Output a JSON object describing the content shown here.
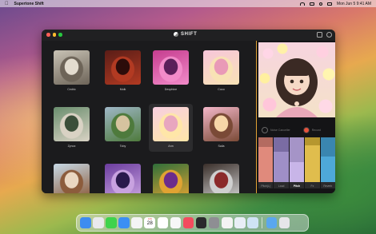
{
  "menubar": {
    "app_name": "Supertone Shift",
    "date_time": "Mon Jun 5  9:41 AM"
  },
  "window": {
    "title": "SHIFT"
  },
  "gallery": {
    "items": [
      {
        "label": "Cedric",
        "palette": [
          "#c8c2b5",
          "#6d6458",
          "#e3dccf"
        ],
        "selected": false
      },
      {
        "label": "Molk",
        "palette": [
          "#5a1d17",
          "#b23a22",
          "#2c0c0a"
        ],
        "selected": false
      },
      {
        "label": "Deophine",
        "palette": [
          "#c53d8f",
          "#f28bc9",
          "#5b1f5a"
        ],
        "selected": false
      },
      {
        "label": "Coco",
        "palette": [
          "#f7c6da",
          "#f8e2b5",
          "#e99ab7"
        ],
        "selected": false
      },
      {
        "label": "Zynox",
        "palette": [
          "#6a8e6e",
          "#d9d2c4",
          "#3b4f3a"
        ],
        "selected": false
      },
      {
        "label": "Toby",
        "palette": [
          "#9fb7c7",
          "#4e7a3c",
          "#d6c39f"
        ],
        "selected": false
      },
      {
        "label": "Ann",
        "palette": [
          "#f7cfe0",
          "#ffe6a8",
          "#e8a6bf"
        ],
        "selected": true
      },
      {
        "label": "Saila",
        "palette": [
          "#f3b7c9",
          "#7a4a36",
          "#f6d7a8"
        ],
        "selected": false
      },
      {
        "label": "",
        "palette": [
          "#c7d9e6",
          "#8c5c3c",
          "#ead7c1"
        ],
        "selected": false
      },
      {
        "label": "",
        "palette": [
          "#6b3d9e",
          "#c8a2e0",
          "#2a1a4c"
        ],
        "selected": false
      },
      {
        "label": "",
        "palette": [
          "#2f6e3a",
          "#e0a332",
          "#6b2c8c"
        ],
        "selected": false
      },
      {
        "label": "",
        "palette": [
          "#3a2f2a",
          "#cfcfcf",
          "#8b2a2a"
        ],
        "selected": false
      }
    ]
  },
  "panel": {
    "left_control_label": "Noise Canceller",
    "right_control_label": "Record",
    "sliders": [
      {
        "label": "Pitch(L)",
        "fill_color": "#e08a7c",
        "top_color": "#b46b60",
        "level": 0.78,
        "active": false
      },
      {
        "label": "Loud",
        "fill_color": "#9f8fc7",
        "top_color": "#7a6ca3",
        "level": 0.68,
        "active": false
      },
      {
        "label": "Pitch",
        "fill_color": "#c8b5e8",
        "top_color": "#a594c7",
        "level": 0.45,
        "active": true
      },
      {
        "label": "Fx",
        "fill_color": "#e0bd4d",
        "top_color": "#b6972f",
        "level": 0.82,
        "active": false
      },
      {
        "label": "Reverb",
        "fill_color": "#4ea8d8",
        "top_color": "#3a86b0",
        "level": 0.58,
        "active": false
      }
    ]
  },
  "dock": {
    "apps": [
      {
        "name": "finder-icon",
        "color": "#3d8cf0"
      },
      {
        "name": "launchpad-icon",
        "color": "#e9e9ee"
      },
      {
        "name": "messages-icon",
        "color": "#3fd34c"
      },
      {
        "name": "mail-icon",
        "color": "#3b8ff3"
      },
      {
        "name": "photos-icon",
        "color": "#f4f4f4"
      },
      {
        "name": "calendar-icon",
        "color": "#ffffff"
      },
      {
        "name": "reminders-icon",
        "color": "#ffffff"
      },
      {
        "name": "notes-icon",
        "color": "#f7f7f7"
      },
      {
        "name": "music-icon",
        "color": "#f34b5e"
      },
      {
        "name": "shift-icon",
        "color": "#2a2a2c"
      },
      {
        "name": "settings-icon",
        "color": "#8e8e93"
      },
      {
        "name": "pages-icon",
        "color": "#f3f3f3"
      },
      {
        "name": "preview-icon",
        "color": "#e8eef6"
      },
      {
        "name": "window-icon",
        "color": "#cfe3f5"
      }
    ],
    "calendar": {
      "month": "JUN",
      "day": "28"
    },
    "trailing": [
      {
        "name": "folder-icon",
        "color": "#5aa7ee"
      },
      {
        "name": "trash-icon",
        "color": "#e6e6ea"
      }
    ]
  }
}
